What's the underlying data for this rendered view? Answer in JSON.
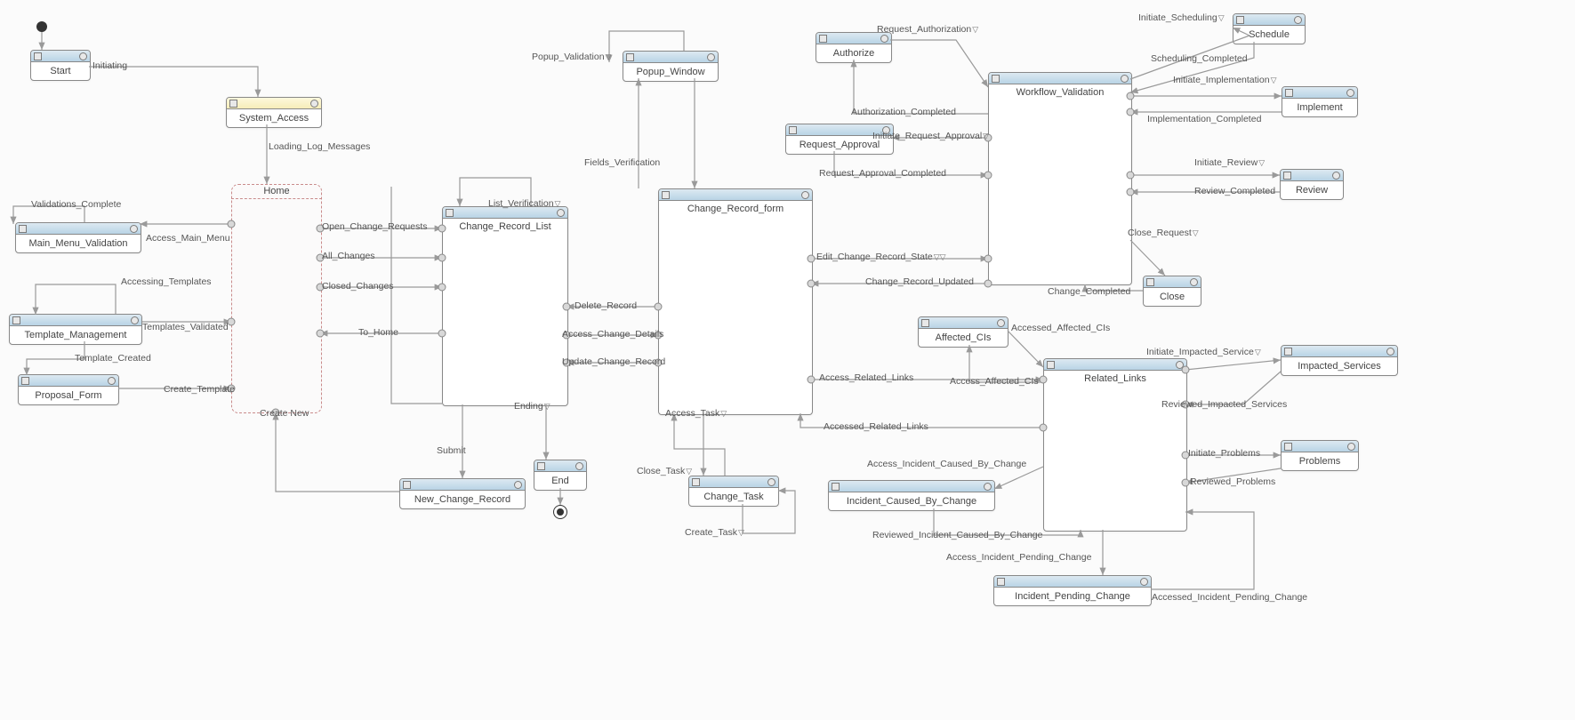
{
  "states": {
    "start": "Start",
    "system_access": "System_Access",
    "main_menu_validation": "Main_Menu_Validation",
    "template_management": "Template_Management",
    "proposal_form": "Proposal_Form",
    "home": "Home",
    "change_record_list": "Change_Record_List",
    "new_change_record": "New_Change_Record",
    "end": "End",
    "popup_window": "Popup_Window",
    "change_record_form": "Change_Record_form",
    "change_task": "Change_Task",
    "authorize": "Authorize",
    "request_approval": "Request_Approval",
    "affected_cis": "Affected_CIs",
    "incident_caused_by_change": "Incident_Caused_By_Change",
    "incident_pending_change": "Incident_Pending_Change",
    "workflow_validation": "Workflow_Validation",
    "related_links": "Related_Links",
    "schedule": "Schedule",
    "implement": "Implement",
    "review": "Review",
    "close": "Close",
    "impacted_services": "Impacted_Services",
    "problems": "Problems"
  },
  "transitions": {
    "initiating": "Initiating",
    "loading_log_messages": "Loading_Log_Messages",
    "validations_complete": "Validations_Complete",
    "access_main_menu": "Access_Main_Menu",
    "accessing_templates": "Accessing_Templates",
    "templates_validated": "Templates_Validated",
    "template_created": "Template_Created",
    "create_template": "Create_Template",
    "create_new": "Create New",
    "open_change_requests": "Open_Change_Requests",
    "all_changes": "All_Changes",
    "closed_changes": "Closed_Changes",
    "to_home": "To_Home",
    "list_verification": "List_Verification",
    "submit": "Submit",
    "ending": "Ending",
    "popup_validation": "Popup_Validation",
    "fields_verification": "Fields_Verification",
    "delete_record": "Delete_Record",
    "access_change_details": "Access_Change_Details",
    "update_change_record": "Update_Change_Record",
    "access_task": "Access_Task",
    "close_task": "Close_Task",
    "create_task": "Create_Task",
    "request_authorization": "Request_Authorization",
    "authorization_completed": "Authorization_Completed",
    "initiate_request_approval": "Initiate_Request_Approval",
    "request_approval_completed": "Request_Approval_Completed",
    "edit_change_record_state": "Edit_Change_Record_State",
    "change_record_updated": "Change_Record_Updated",
    "access_related_links": "Access_Related_Links",
    "accessed_related_links": "Accessed_Related_Links",
    "accessed_affected_cis": "Accessed_Affected_CIs",
    "access_affected_cis": "Access_Affected_CIs",
    "access_incident_caused_by_change": "Access_Incident_Caused_By_Change",
    "reviewed_incident_caused_by_change": "Reviewed_Incident_Caused_By_Change",
    "access_incident_pending_change": "Access_Incident_Pending_Change",
    "accessed_incident_pending_change": "Accessed_Incident_Pending_Change",
    "initiate_scheduling": "Initiate_Scheduling",
    "scheduling_completed": "Scheduling_Completed",
    "initiate_implementation": "Initiate_Implementation",
    "implementation_completed": "Implementation_Completed",
    "initiate_review": "Initiate_Review",
    "review_completed": "Review_Completed",
    "close_request": "Close_Request",
    "change_completed": "Change_Completed",
    "initiate_impacted_service": "Initiate_Impacted_Service",
    "reviewed_impacted_services": "Reviewed_Impacted_Services",
    "initiate_problems": "Initiate_Problems",
    "reviewed_problems": "Reviewed_Problems"
  }
}
